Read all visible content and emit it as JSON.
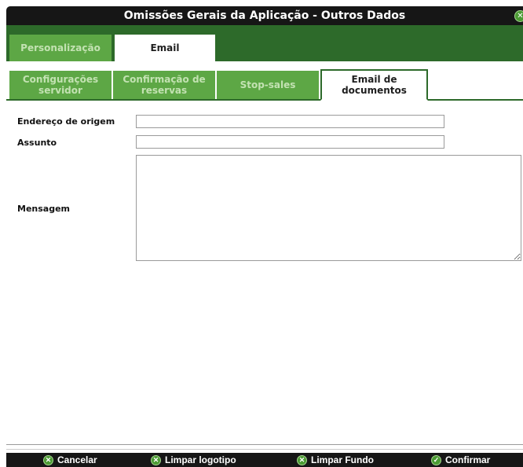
{
  "window": {
    "title": "Omissões Gerais da Aplicação - Outros Dados",
    "close_icon": "x-icon"
  },
  "main_tabs": [
    {
      "label": "Personalização",
      "active": false
    },
    {
      "label": "Email",
      "active": true
    }
  ],
  "sub_tabs": [
    {
      "line1": "Configurações",
      "line2": "servidor",
      "active": false
    },
    {
      "line1": "Confirmação de",
      "line2": "reservas",
      "active": false
    },
    {
      "line1": "Stop-sales",
      "line2": "",
      "active": false
    },
    {
      "line1": "Email de",
      "line2": "documentos",
      "active": true
    }
  ],
  "form": {
    "origin_label": "Endereço de origem",
    "origin_value": "",
    "subject_label": "Assunto",
    "subject_value": "",
    "message_label": "Mensagem",
    "message_value": ""
  },
  "footer": {
    "cancel_label": "Cancelar",
    "clear_logo_label": "Limpar logotipo",
    "clear_background_label": "Limpar Fundo",
    "confirm_label": "Confirmar"
  },
  "colors": {
    "title_bar": "#161616",
    "tab_strip": "#2d6a2a",
    "inactive_tab": "#5da745",
    "icon_green": "#4b9a33"
  }
}
